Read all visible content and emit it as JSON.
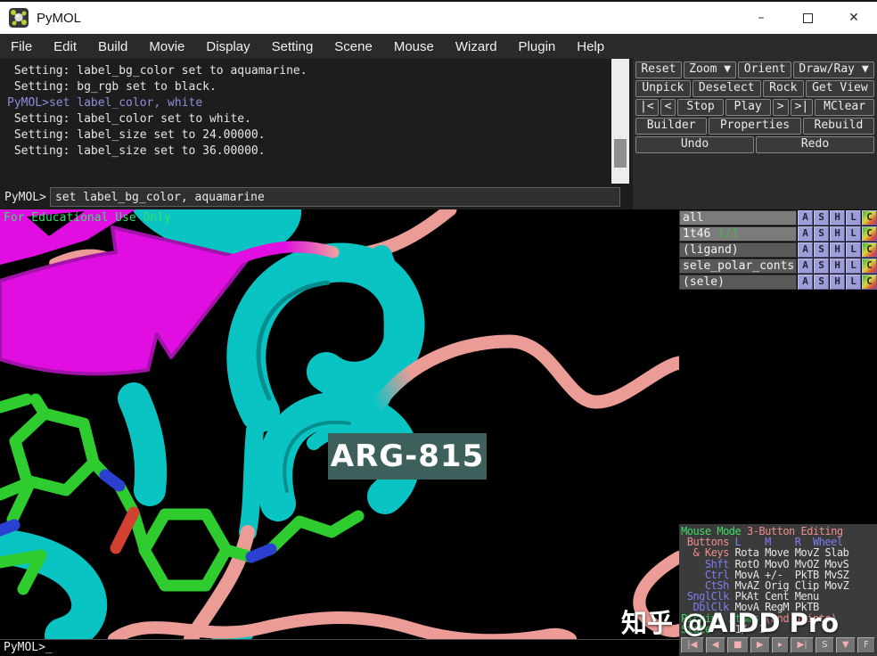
{
  "window": {
    "title": "PyMOL",
    "minimize": "–",
    "maximize": "",
    "close": "✕"
  },
  "menu": {
    "items": [
      "File",
      "Edit",
      "Build",
      "Movie",
      "Display",
      "Setting",
      "Scene",
      "Mouse",
      "Wizard",
      "Plugin",
      "Help"
    ]
  },
  "console": {
    "lines": [
      {
        "t": " Setting: label_bg_color set to aquamarine.",
        "c": "white"
      },
      {
        "t": " Setting: bg_rgb set to black.",
        "c": "white"
      },
      {
        "t": "PyMOL>set label_color, white",
        "c": "violet"
      },
      {
        "t": " Setting: label_color set to white.",
        "c": "white"
      },
      {
        "t": " Setting: label_size set to 24.00000.",
        "c": "white"
      },
      {
        "t": " Setting: label_size set to 36.00000.",
        "c": "white"
      }
    ],
    "prompt": "PyMOL>",
    "input_value": "set label_bg_color, aquamarine"
  },
  "controls": {
    "rows": [
      [
        "Reset",
        "Zoom ▼",
        "Orient",
        "Draw/Ray ▼"
      ],
      [
        "Unpick",
        "Deselect",
        "Rock",
        "Get View"
      ],
      [
        "|<",
        "<",
        "Stop",
        "Play",
        ">",
        ">|",
        "MClear"
      ],
      [
        "Builder",
        "Properties",
        "Rebuild"
      ],
      [
        "Undo",
        "Redo"
      ]
    ]
  },
  "objects": {
    "action_buttons": [
      "A",
      "S",
      "H",
      "L",
      "C"
    ],
    "rows": [
      {
        "name": "all",
        "state": ""
      },
      {
        "name": "1t46 ",
        "state": "1/1"
      },
      {
        "name": "(ligand)",
        "state": ""
      },
      {
        "name": "sele_polar_conts",
        "state": ""
      },
      {
        "name": "(sele)",
        "state": ""
      }
    ]
  },
  "viewport": {
    "edu_notice": "For Educational Use Only",
    "residue_label": "ARG-815",
    "colors": {
      "background": "#000000",
      "cartoon_magenta": "#e10ee1",
      "cartoon_magenta_edge": "#a012a8",
      "helix_cyan": "#0ac4c4",
      "helix_cyan_dark": "#068e8e",
      "loop_salmon": "#ec9c96",
      "ligand_green": "#2ecc2e",
      "nitrogen_blue": "#2b3fd1",
      "oxygen_red": "#d14030",
      "label_bg": "#3d605c",
      "label_text": "#fdfdfd",
      "edu_green": "#35e06a"
    }
  },
  "mouse_panel": {
    "lines": [
      {
        "a": "Mouse Mode",
        "ac": "green",
        "b": " 3-Button Editing",
        "bc": "salmon"
      },
      {
        "a": " Buttons",
        "ac": "salmon",
        "b": " L    M    R  Wheel",
        "bc": "blue"
      },
      {
        "a": "  & Keys",
        "ac": "salmon",
        "b": " Rota Move MovZ Slab",
        "bc": "white"
      },
      {
        "a": "    Shft",
        "ac": "blue",
        "b": " RotO MovO MvOZ MovS",
        "bc": "white"
      },
      {
        "a": "    Ctrl",
        "ac": "blue",
        "b": " MovA +/-  PkTB MvSZ",
        "bc": "white"
      },
      {
        "a": "    CtSh",
        "ac": "blue",
        "b": " MvAZ Orig Clip MovZ",
        "bc": "white"
      },
      {
        "a": " SnglClk",
        "ac": "blue",
        "b": " PkAt Cent Menu",
        "bc": "white"
      },
      {
        "a": "  DblClk",
        "ac": "blue",
        "b": " MovA RegM PkTB",
        "bc": "white"
      },
      {
        "a": "Picking Atoms",
        "ac": "green",
        "b": " (and Joints)",
        "bc": "salmon"
      },
      {
        "a": "State",
        "ac": "green",
        "b": "    1/  1",
        "bc": "white"
      }
    ]
  },
  "playback": {
    "buttons": [
      {
        "g": "|◀",
        "c": "salmon"
      },
      {
        "g": "◀",
        "c": "salmon"
      },
      {
        "g": "■",
        "c": "salmon"
      },
      {
        "g": "▶",
        "c": "salmon"
      },
      {
        "g": "▸",
        "c": "salmon"
      },
      {
        "g": "▶|",
        "c": "salmon"
      },
      {
        "g": "S",
        "c": "gray"
      },
      {
        "g": "▼",
        "c": "salmon"
      },
      {
        "g": "F",
        "c": "gray"
      }
    ]
  },
  "bottom_prompt": "PyMOL>_",
  "watermark": "知乎 @AIDD Pro"
}
